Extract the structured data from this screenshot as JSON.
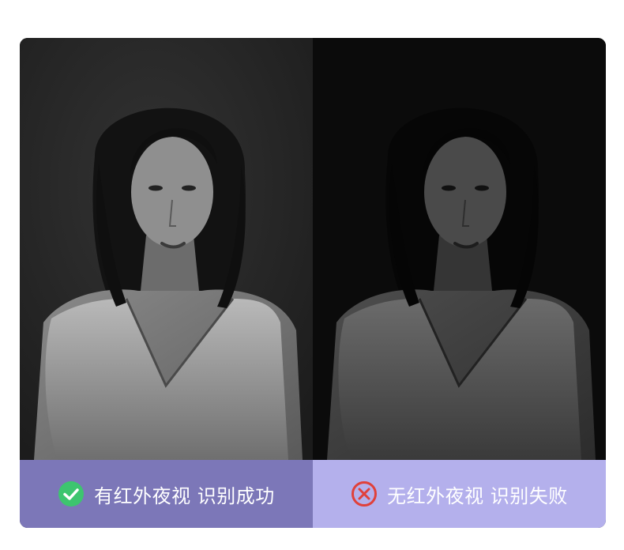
{
  "panels": {
    "left": {
      "caption": "有红外夜视 识别成功",
      "status_icon": "check-circle-icon",
      "bar_color": "#7c77b8",
      "icon_color": "#3dc56f"
    },
    "right": {
      "caption": "无红外夜视 识别失败",
      "status_icon": "x-circle-icon",
      "bar_color": "#b4b0ec",
      "icon_color": "#e0403a"
    }
  }
}
